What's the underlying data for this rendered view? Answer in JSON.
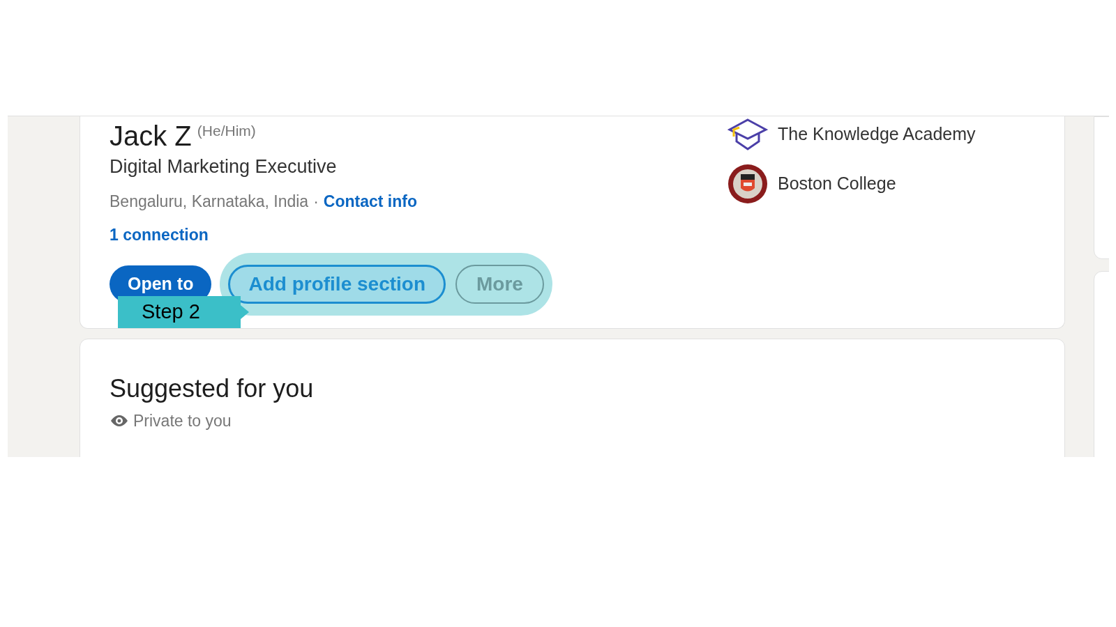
{
  "profile": {
    "name": "Jack Z",
    "pronouns": "(He/Him)",
    "headline": "Digital Marketing Executive",
    "location": "Bengaluru, Karnataka, India",
    "separator": "·",
    "contact_link": "Contact info",
    "connections": "1 connection",
    "buttons": [
      {
        "kind": "primary",
        "label": "Open to",
        "highlighted": false
      },
      {
        "kind": "outline",
        "label": "Add profile section",
        "highlighted": true
      },
      {
        "kind": "secondary",
        "label": "More",
        "highlighted": true
      }
    ],
    "education": [
      {
        "kind": "academy",
        "name": "The Knowledge Academy"
      },
      {
        "kind": "college",
        "name": "Boston College"
      }
    ]
  },
  "suggested": {
    "title": "Suggested for you",
    "subtitle": "Private to you"
  },
  "callout": {
    "label": "Step 2"
  }
}
